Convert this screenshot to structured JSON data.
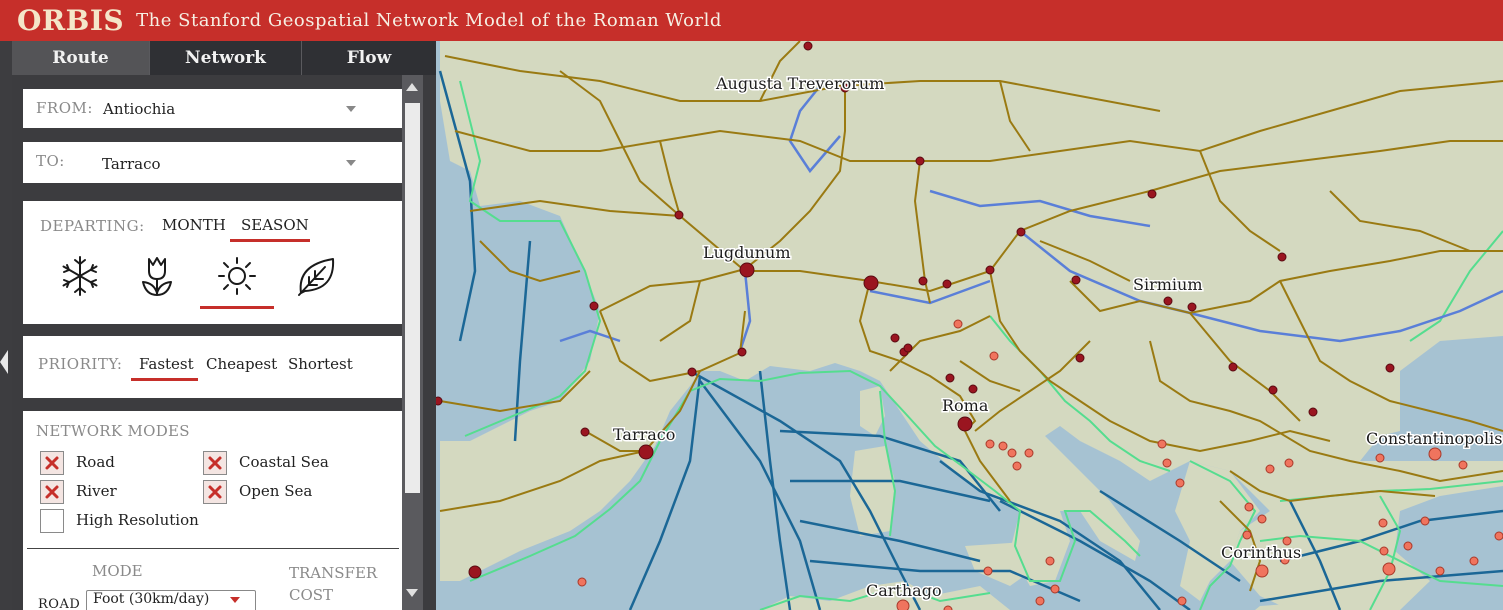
{
  "header": {
    "app_name": "ORBIS",
    "subtitle": "The Stanford Geospatial Network Model of the Roman World",
    "background": "#c62f2a"
  },
  "tabs": [
    {
      "label": "Route",
      "active": true
    },
    {
      "label": "Network",
      "active": false
    },
    {
      "label": "Flow",
      "active": false
    }
  ],
  "route": {
    "from": {
      "label": "FROM:",
      "value": "Antiochia"
    },
    "to": {
      "label": "TO:",
      "value": "Tarraco"
    },
    "departing": {
      "label": "DEPARTING:",
      "month_label": "MONTH",
      "season_label": "SEASON",
      "selected_mode": "SEASON",
      "seasons": [
        {
          "icon": "snowflake-icon",
          "name": "winter"
        },
        {
          "icon": "tulip-icon",
          "name": "spring"
        },
        {
          "icon": "sun-icon",
          "name": "summer"
        },
        {
          "icon": "leaf-icon",
          "name": "autumn"
        }
      ],
      "selected_season": "summer"
    },
    "priority": {
      "label": "PRIORITY:",
      "options": [
        "Fastest",
        "Cheapest",
        "Shortest"
      ],
      "selected": "Fastest"
    },
    "network_modes": {
      "label": "NETWORK MODES",
      "items": [
        {
          "label": "Road",
          "checked": true
        },
        {
          "label": "Coastal Sea",
          "checked": true
        },
        {
          "label": "River",
          "checked": true
        },
        {
          "label": "Open Sea",
          "checked": true
        },
        {
          "label": "High Resolution",
          "checked": false
        }
      ],
      "mode_header": "MODE",
      "transfer_header_line1": "TRANSFER",
      "transfer_header_line2": "COST",
      "road_row_label": "ROAD",
      "road_mode_value": "Foot (30km/day)"
    }
  },
  "map": {
    "cities": [
      "Augusta Treverorum",
      "Lugdunum",
      "Sirmium",
      "Roma",
      "Tarraco",
      "Constantinopolis",
      "Corinthus",
      "Carthago"
    ],
    "colors": {
      "sea": "#a6c2d2",
      "land": "#d4d9c0",
      "road": "#9a7a12",
      "river": "#5a7fd8",
      "coastal_sea": "#55dd8f",
      "open_sea": "#1b6796",
      "city_node": "#9a1520",
      "coastal_node": "#f0745e"
    }
  }
}
